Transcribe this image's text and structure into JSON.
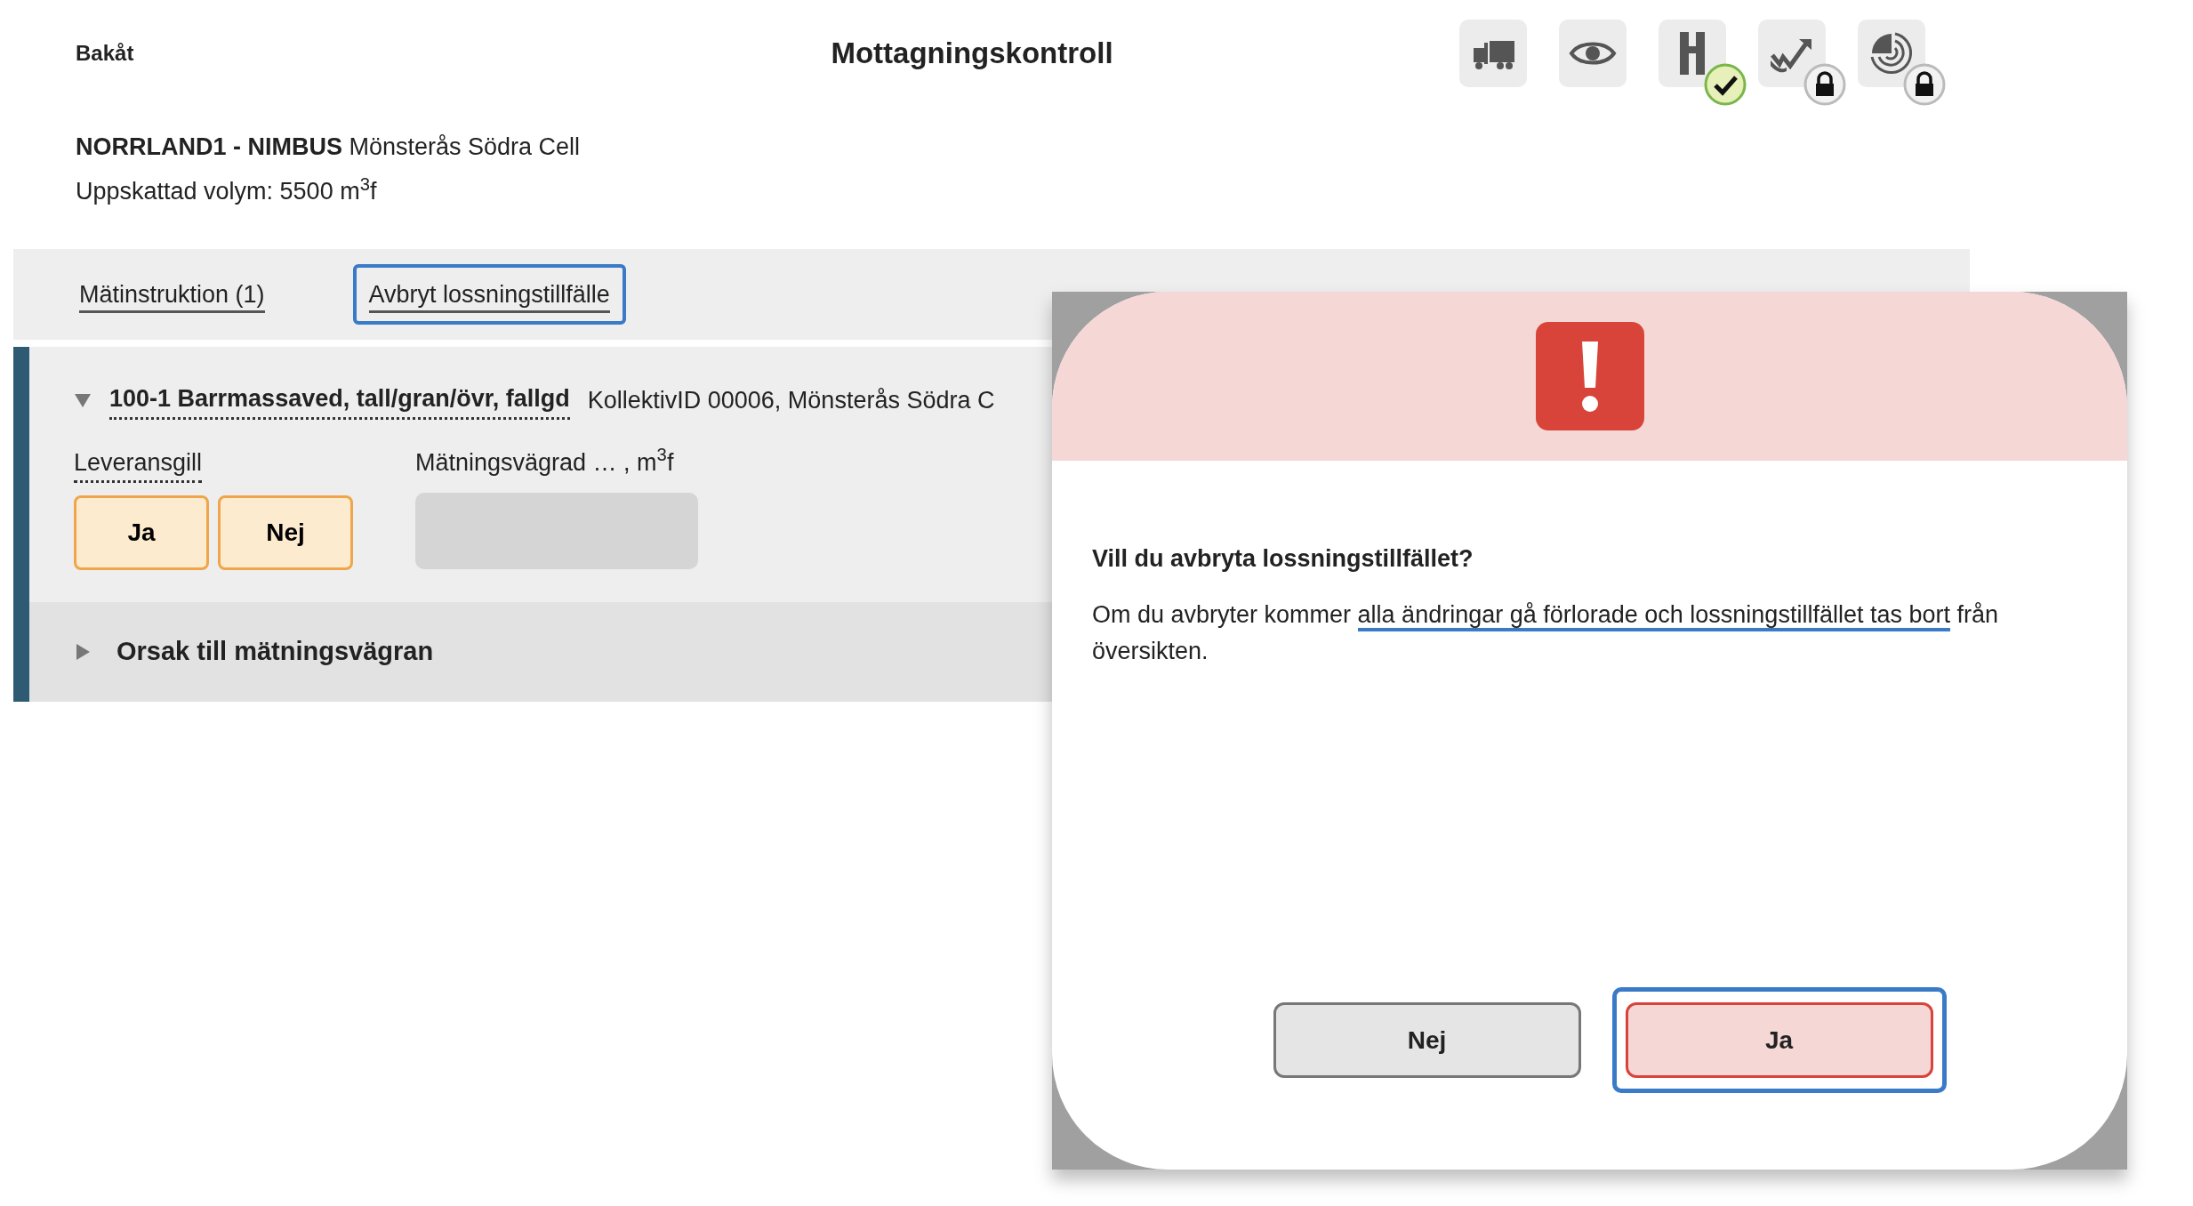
{
  "header": {
    "back_label": "Bakåt",
    "title": "Mottagningskontroll",
    "toolbar": [
      {
        "kind": "truck",
        "approved": false,
        "locked": false
      },
      {
        "kind": "eye",
        "approved": false,
        "locked": false
      },
      {
        "kind": "road",
        "approved": true,
        "locked": false
      },
      {
        "kind": "signature",
        "approved": false,
        "locked": true
      },
      {
        "kind": "radar",
        "approved": false,
        "locked": true
      }
    ]
  },
  "info": {
    "supplier": "NORRLAND1 - NIMBUS",
    "site": "Mönsterås Södra Cell",
    "volume": "Uppskattad volym: 5500 m$^{3}$f"
  },
  "actions": [
    {
      "label": "Mätinstruktion (1)",
      "focused": false
    },
    {
      "label": "Avbryt lossningstillfälle",
      "focused": true
    }
  ],
  "sections": [
    {
      "title": "100-1 Barrmassaved, tall/gran/övr, fallgd",
      "detail": "KollektivID 00006, Mönsterås Södra C",
      "expanded": true,
      "delivery_label": "Leveransgill",
      "delivery_options": [
        "Ja",
        "Nej"
      ],
      "refused_label": "Mätningsvägrad …  , m$^{3}$f",
      "refused_field": {
        "disabled": true
      }
    },
    {
      "title": "Orsak till mätningsvägran",
      "expanded": false
    }
  ],
  "dialog": {
    "question": "Vill du avbryta lossningstillfället?",
    "message": [
      {
        "text": "Om du avbryter kommer ",
        "underlined": false
      },
      {
        "text": "alla ändringar gå förlorade och lossningstillfället tas bort",
        "underlined": true
      },
      {
        "text": " från översikten.",
        "underlined": false
      }
    ],
    "buttons": [
      {
        "label": "Nej",
        "kind": "cancel",
        "focused": false
      },
      {
        "label": "Ja",
        "kind": "confirm",
        "focused": true
      }
    ]
  }
}
